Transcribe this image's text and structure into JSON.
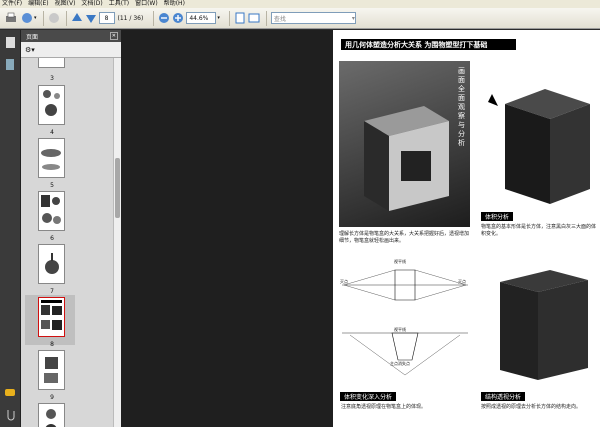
{
  "menu": [
    "文件(F)",
    "编辑(E)",
    "视图(V)",
    "文档(D)",
    "工具(T)",
    "窗口(W)",
    "帮助(H)"
  ],
  "toolbar": {
    "current_page": "8",
    "page_total": "(11 / 36)",
    "zoom": "44.6%",
    "search_placeholder": "查找"
  },
  "panel": {
    "title": "页面"
  },
  "thumbnails": [
    "3",
    "4",
    "5",
    "6",
    "7",
    "8",
    "9"
  ],
  "page": {
    "title": "用几何体塑造分析大关系 为围物塑型打下基础",
    "photo_text": "画面全面观察与分析",
    "caption1": "理解长方体是物笔盒的大关系，大关系把握好后，透视增加细节，物笔盒就轻松画出来。",
    "tag1": "体积分析",
    "caption2": "物笔盒的基本形体是长方体，注意黑白灰三大面的体积变化。",
    "tag2": "体积变化深入分析",
    "caption3": "注意底角透视原理在物笔盒上的体现。",
    "tag3": "结构透视分析",
    "caption4": "按照成透视的原理去分析长方体的结构走向。",
    "diagram_labels": {
      "top": "视平线",
      "left": "灭点",
      "right": "灭点",
      "mid": "视平线",
      "bottom": "主点消失点"
    }
  }
}
